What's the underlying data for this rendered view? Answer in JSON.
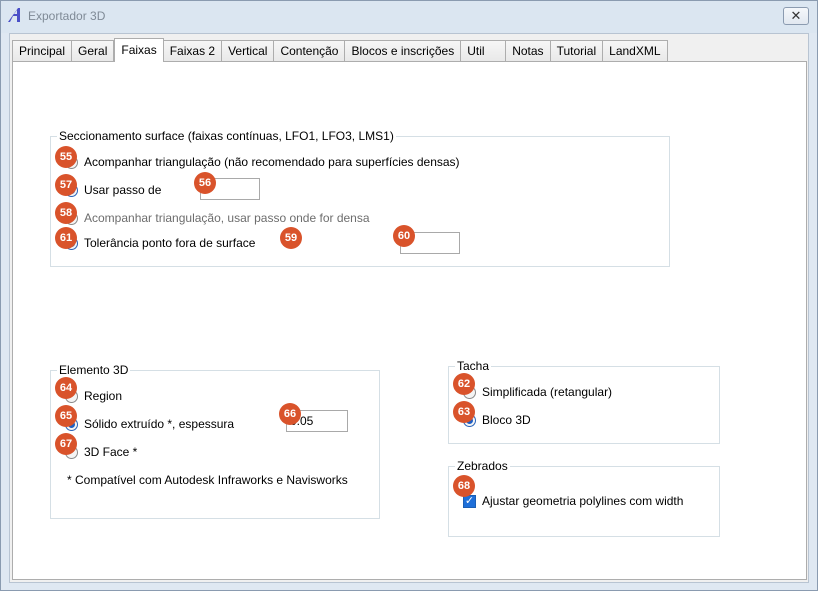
{
  "window": {
    "title": "Exportador 3D",
    "close_glyph": "✕"
  },
  "tabs": [
    {
      "label": "Principal",
      "active": false
    },
    {
      "label": "Geral",
      "active": false
    },
    {
      "label": "Faixas",
      "active": true
    },
    {
      "label": "Faixas 2",
      "active": false
    },
    {
      "label": "Vertical",
      "active": false
    },
    {
      "label": "Contenção",
      "active": false
    },
    {
      "label": "Blocos e inscrições",
      "active": false
    },
    {
      "label": "Util",
      "active": false
    },
    {
      "label": "Notas",
      "active": false
    },
    {
      "label": "Tutorial",
      "active": false
    },
    {
      "label": "LandXML",
      "active": false
    }
  ],
  "seccionamento": {
    "legend": "Seccionamento surface (faixas contínuas, LFO1, LFO3, LMS1)",
    "opt_acompanhar": "Acompanhar triangulação (não recomendado para superfícies densas)",
    "opt_usar_passo": "Usar passo de",
    "usar_passo_value": "",
    "opt_acompanhar_passo": "Acompanhar triangulação, usar passo onde for densa",
    "opt_tolerancia": "Tolerância ponto fora de surface",
    "tolerancia_value": ""
  },
  "elemento3d": {
    "legend": "Elemento 3D",
    "opt_region": "Region",
    "opt_solido": "Sólido extruído *, espessura",
    "espessura_value": "0.05",
    "opt_3dface": "3D Face *",
    "note": "* Compatível com Autodesk Infraworks e Navisworks"
  },
  "tacha": {
    "legend": "Tacha",
    "opt_simplificada": "Simplificada (retangular)",
    "opt_bloco3d": "Bloco 3D"
  },
  "zebrados": {
    "legend": "Zebrados",
    "opt_ajustar": "Ajustar geometria polylines com width"
  },
  "badges": [
    "55",
    "56",
    "57",
    "58",
    "59",
    "60",
    "61",
    "62",
    "63",
    "64",
    "65",
    "66",
    "67",
    "68"
  ],
  "colors": {
    "badge": "#d9532b",
    "accent": "#1e6fd9"
  }
}
